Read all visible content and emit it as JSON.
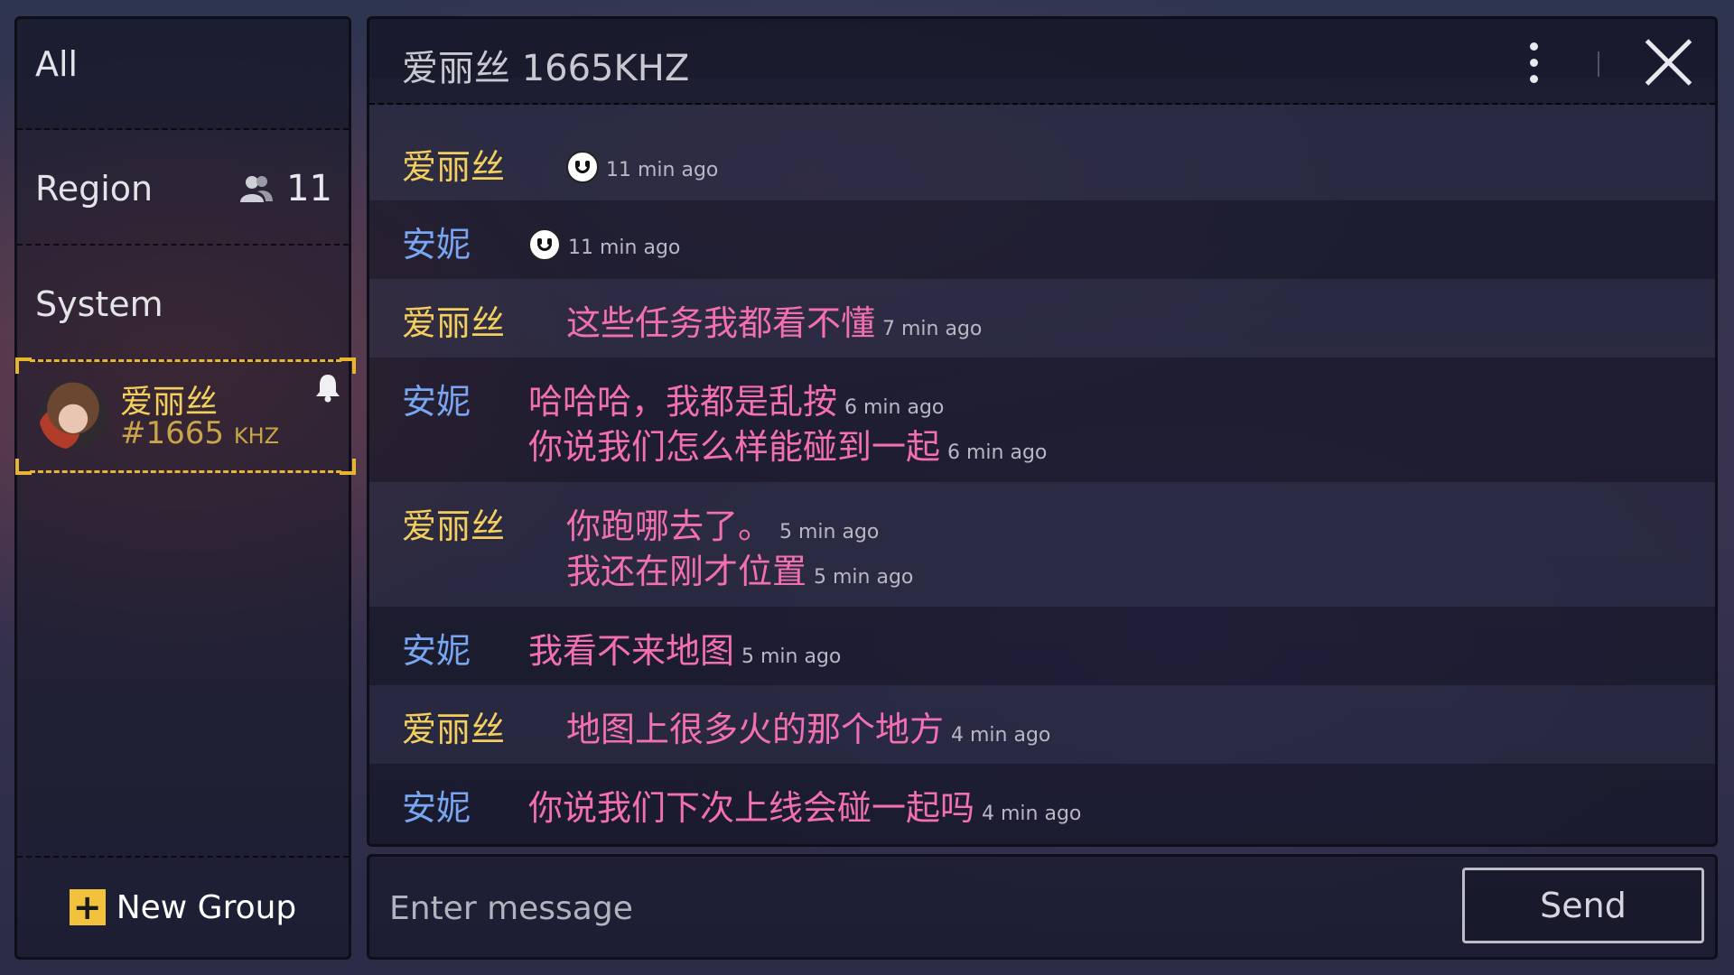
{
  "sidebar": {
    "tabs": [
      {
        "label": "All"
      },
      {
        "label": "Region",
        "count": "11"
      },
      {
        "label": "System"
      }
    ],
    "contact": {
      "name": "爱丽丝",
      "freq": "#1665",
      "unit": "KHZ"
    },
    "new_group_label": "New Group"
  },
  "chat": {
    "title": "爱丽丝 1665KHZ",
    "messages": [
      {
        "sender": "爱丽丝",
        "lines": [
          {
            "text": "",
            "emoji": "smiley",
            "time": "11 min ago"
          }
        ]
      },
      {
        "sender": "安妮",
        "lines": [
          {
            "text": "",
            "emoji": "smiley",
            "time": "11 min ago"
          }
        ]
      },
      {
        "sender": "爱丽丝",
        "lines": [
          {
            "text": "这些任务我都看不懂",
            "time": "7 min ago"
          }
        ]
      },
      {
        "sender": "安妮",
        "lines": [
          {
            "text": "哈哈哈，我都是乱按",
            "time": "6 min ago"
          },
          {
            "text": "你说我们怎么样能碰到一起",
            "time": "6 min ago"
          }
        ]
      },
      {
        "sender": "爱丽丝",
        "lines": [
          {
            "text": "你跑哪去了。",
            "time": "5 min ago"
          },
          {
            "text": "我还在刚才位置",
            "time": "5 min ago"
          }
        ]
      },
      {
        "sender": "安妮",
        "lines": [
          {
            "text": "我看不来地图",
            "time": "5 min ago"
          }
        ]
      },
      {
        "sender": "爱丽丝",
        "lines": [
          {
            "text": "地图上很多火的那个地方",
            "time": "4 min ago"
          }
        ]
      },
      {
        "sender": "安妮",
        "lines": [
          {
            "text": "你说我们下次上线会碰一起吗",
            "time": "4 min ago"
          }
        ]
      }
    ]
  },
  "input": {
    "placeholder": "Enter message",
    "send_label": "Send"
  },
  "colors": {
    "alice": "#f3cf5d",
    "anne": "#79a6f2",
    "message": "#f26fb0",
    "highlight": "#e6b631"
  }
}
